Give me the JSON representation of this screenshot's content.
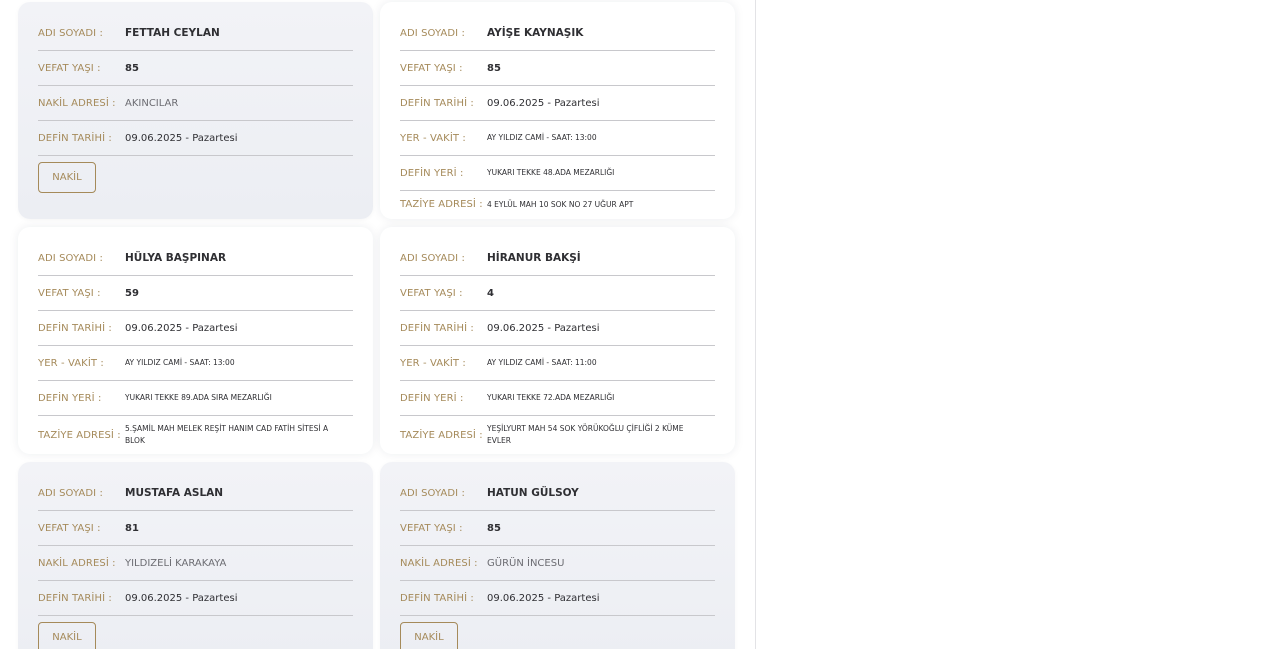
{
  "labels": {
    "name": "ADI SOYADI :",
    "age": "VEFAT YAŞI :",
    "transfer": "NAKİL ADRESİ :",
    "burial_date": "DEFİN TARİHİ :",
    "place_time": "YER - VAKİT :",
    "burial_place": "DEFİN YERİ :",
    "condolence": "TAZİYE ADRESİ :",
    "nakil_button": "NAKİL"
  },
  "cards": [
    {
      "name": "FETTAH CEYLAN",
      "age": "85",
      "transfer": "AKINCILAR",
      "burial_date": "09.06.2025 - Pazartesi"
    },
    {
      "name": "AYİŞE KAYNAŞIK",
      "age": "85",
      "burial_date": "09.06.2025 - Pazartesi",
      "place_time": "AY YILDIZ CAMİ - SAAT: 13:00",
      "burial_place": "YUKARI TEKKE 48.ADA MEZARLIĞI",
      "condolence": "4 EYLÜL MAH 10 SOK NO 27 UĞUR APT"
    },
    {
      "name": "HÜLYA BAŞPINAR",
      "age": "59",
      "burial_date": "09.06.2025 - Pazartesi",
      "place_time": "AY YILDIZ CAMİ - SAAT: 13:00",
      "burial_place": "YUKARI TEKKE 89.ADA SIRA MEZARLIĞI",
      "condolence": "5.ŞAMİL MAH MELEK REŞİT HANIM CAD FATİH SİTESİ A BLOK"
    },
    {
      "name": "HİRANUR BAKŞİ",
      "age": "4",
      "burial_date": "09.06.2025 - Pazartesi",
      "place_time": "AY YILDIZ CAMİ - SAAT: 11:00",
      "burial_place": "YUKARI TEKKE 72.ADA MEZARLIĞI",
      "condolence": "YEŞİLYURT MAH 54 SOK YÖRÜKOĞLU ÇİFLİĞİ 2 KÜME EVLER"
    },
    {
      "name": "MUSTAFA ASLAN",
      "age": "81",
      "transfer": "YILDIZELİ KARAKAYA",
      "burial_date": "09.06.2025 - Pazartesi"
    },
    {
      "name": "HATUN GÜLSOY",
      "age": "85",
      "transfer": "GÜRÜN İNCESU",
      "burial_date": "09.06.2025 - Pazartesi"
    }
  ]
}
